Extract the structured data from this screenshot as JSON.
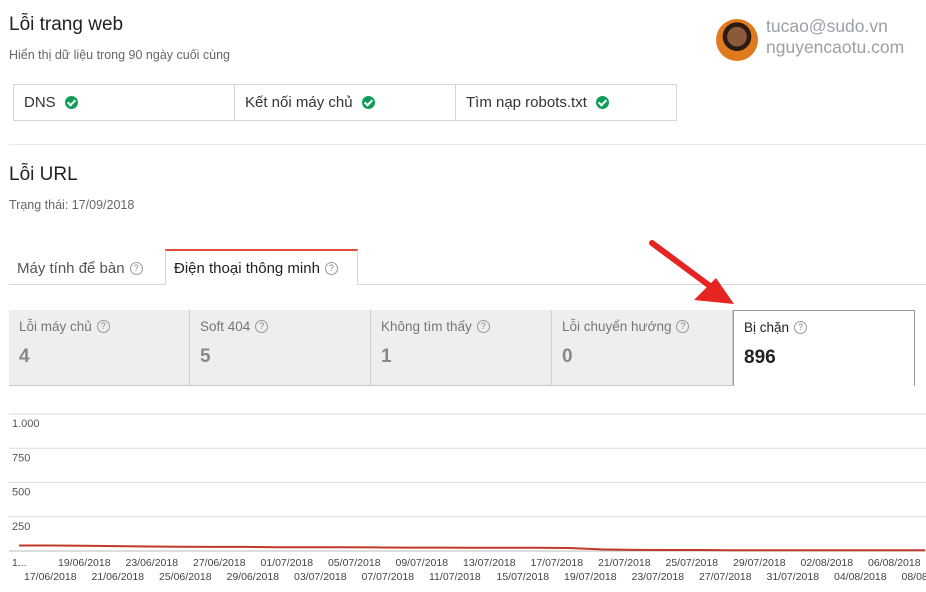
{
  "header": {
    "title": "Lỗi trang web",
    "subtitle": "Hiển thị dữ liệu trong 90 ngày cuối cùng"
  },
  "watermark": {
    "line1": "tucao@sudo.vn",
    "line2": "nguyencaotu.com"
  },
  "site_status": [
    {
      "label": "DNS",
      "status": "ok"
    },
    {
      "label": "Kết nối máy chủ",
      "status": "ok"
    },
    {
      "label": "Tìm nạp robots.txt",
      "status": "ok"
    }
  ],
  "url_errors": {
    "title": "Lỗi URL",
    "status": "Trạng thái: 17/09/2018",
    "tabs": [
      {
        "label": "Máy tính để bàn",
        "active": false
      },
      {
        "label": "Điện thoại thông minh",
        "active": true
      }
    ],
    "help_glyph": "?",
    "metrics": [
      {
        "label": "Lỗi máy chủ",
        "value": "4"
      },
      {
        "label": "Soft 404",
        "value": "5"
      },
      {
        "label": "Không tìm thấy",
        "value": "1"
      },
      {
        "label": "Lỗi chuyển hướng",
        "value": "0"
      },
      {
        "label": "Bị chặn",
        "value": "896"
      }
    ]
  },
  "colors": {
    "accent_tab": "#dd4b39",
    "ok": "#0f9d58",
    "series": "#c0392b",
    "arrow": "#e52521"
  },
  "chart_data": {
    "type": "line",
    "y_ticks": [
      "1.000",
      "750",
      "500",
      "250"
    ],
    "y_values": [
      1000,
      750,
      500,
      250
    ],
    "ylim": [
      0,
      1000
    ],
    "x_labels_top": [
      "1...",
      "19/06/2018",
      "23/06/2018",
      "27/06/2018",
      "01/07/2018",
      "05/07/2018",
      "09/07/2018",
      "13/07/2018",
      "17/07/2018",
      "21/07/2018",
      "25/07/2018",
      "29/07/2018",
      "02/08/2018",
      "06/08/2018"
    ],
    "x_labels_bottom": [
      "17/06/2018",
      "21/06/2018",
      "25/06/2018",
      "29/06/2018",
      "03/07/2018",
      "07/07/2018",
      "11/07/2018",
      "15/07/2018",
      "19/07/2018",
      "23/07/2018",
      "27/07/2018",
      "31/07/2018",
      "04/08/2018",
      "08/08"
    ],
    "series": [
      {
        "values": [
          40,
          40,
          38,
          36,
          33,
          31,
          30,
          30,
          28,
          27,
          27,
          26,
          25,
          25,
          24,
          24,
          23,
          22,
          12,
          8,
          7,
          7,
          6,
          6,
          6,
          6,
          6,
          6,
          6
        ]
      }
    ]
  }
}
